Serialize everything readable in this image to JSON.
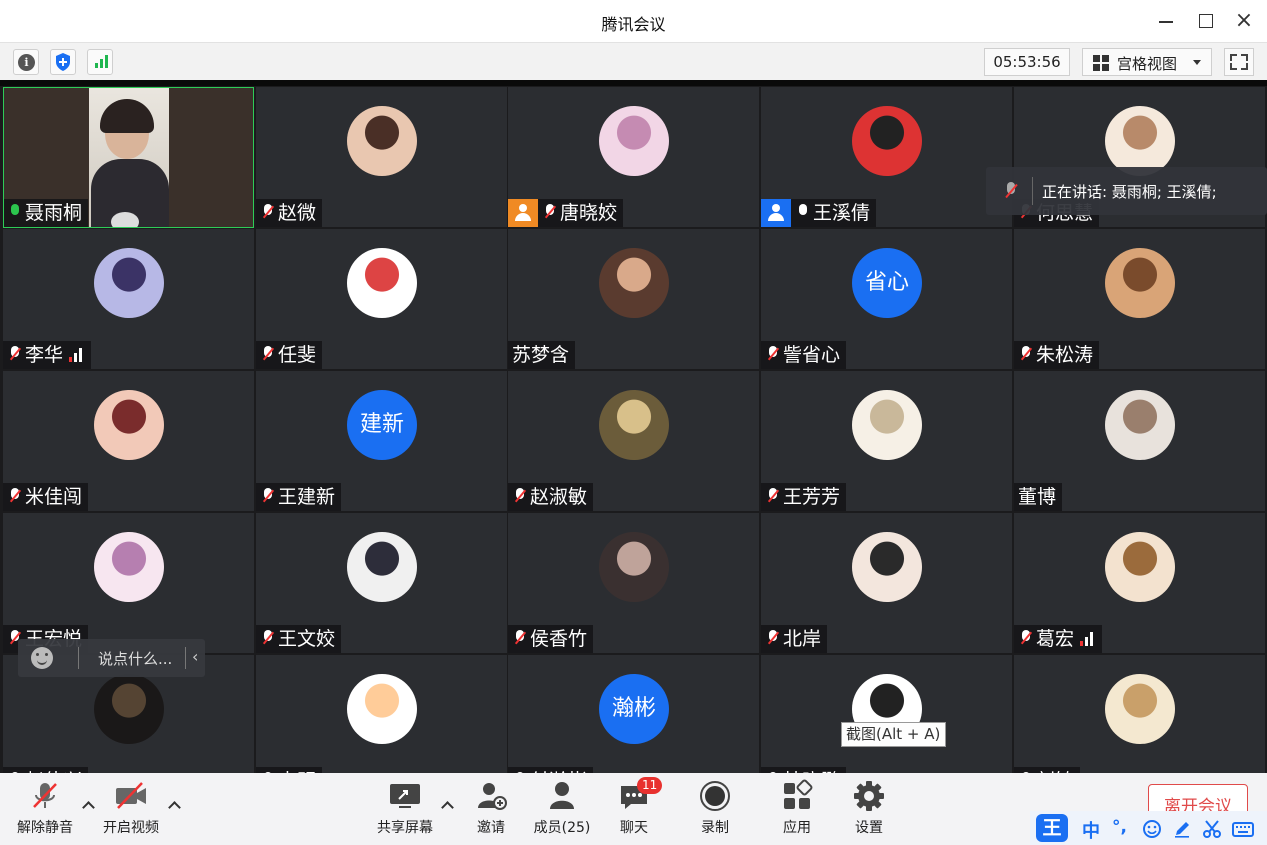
{
  "window": {
    "title": "腾讯会议"
  },
  "toolbar": {
    "info_glyph": "i",
    "timer": "05:53:56",
    "view_label": "宫格视图"
  },
  "colors": {
    "accent": "#1a6ff2",
    "mic_on": "#2cc64e",
    "muted_slash": "#e33333",
    "leave": "#e04a4a",
    "tile_bg": "#2b2d31"
  },
  "participants": [
    {
      "name": "聂雨桐",
      "mic": "on",
      "video": true
    },
    {
      "name": "赵微",
      "mic": "muted"
    },
    {
      "name": "唐晓姣",
      "mic": "muted",
      "host_badge": "orange"
    },
    {
      "name": "王溪倩",
      "mic": "active",
      "host_badge": "blue"
    },
    {
      "name": "何思慧",
      "mic": "muted"
    },
    {
      "name": "李华",
      "mic": "muted",
      "signal": "weak"
    },
    {
      "name": "任斐",
      "mic": "muted"
    },
    {
      "name": "苏梦含",
      "mic": "none"
    },
    {
      "name": "訾省心",
      "mic": "muted",
      "avatar_text": "省心"
    },
    {
      "name": "朱松涛",
      "mic": "muted"
    },
    {
      "name": "米佳闯",
      "mic": "muted"
    },
    {
      "name": "王建新",
      "mic": "muted",
      "avatar_text": "建新"
    },
    {
      "name": "赵淑敏",
      "mic": "muted"
    },
    {
      "name": "王芳芳",
      "mic": "muted"
    },
    {
      "name": "董博",
      "mic": "none"
    },
    {
      "name": "王宏悦",
      "mic": "muted"
    },
    {
      "name": "王文姣",
      "mic": "muted"
    },
    {
      "name": "侯香竹",
      "mic": "muted"
    },
    {
      "name": "北岸",
      "mic": "muted"
    },
    {
      "name": "葛宏",
      "mic": "muted",
      "signal": "weak"
    },
    {
      "name": "赵佳兴",
      "mic": "muted"
    },
    {
      "name": "李明",
      "mic": "muted"
    },
    {
      "name": "付瀚彬",
      "mic": "muted",
      "avatar_text": "瀚彬"
    },
    {
      "name": "韩晓鹏",
      "mic": "muted"
    },
    {
      "name": "刘敏",
      "mic": "muted"
    }
  ],
  "speaking": {
    "text": "正在讲话: 聂雨桐; 王溪倩;"
  },
  "chat_input": {
    "placeholder": "说点什么...",
    "collapse_glyph": "‹"
  },
  "tooltip": {
    "text": "截图(Alt + A)"
  },
  "bottom": {
    "unmute": "解除静音",
    "start_video": "开启视频",
    "share": "共享屏幕",
    "invite": "邀请",
    "members": "成员(25)",
    "chat": "聊天",
    "chat_badge": "11",
    "record": "录制",
    "apps": "应用",
    "settings": "设置",
    "leave": "离开会议"
  },
  "ime": {
    "logo": "王",
    "mode": "中",
    "punct": "°,"
  }
}
